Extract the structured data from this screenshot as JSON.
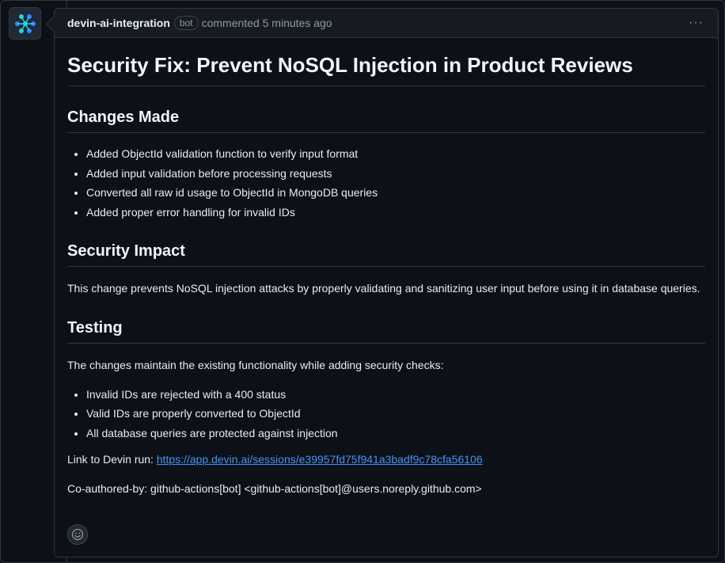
{
  "comment": {
    "author": "devin-ai-integration",
    "badge": "bot",
    "meta": "commented 5 minutes ago",
    "menu_icon": "kebab-horizontal-icon",
    "avatar_icon": "devin-logo-icon"
  },
  "body": {
    "title": "Security Fix: Prevent NoSQL Injection in Product Reviews",
    "sections": [
      {
        "heading": "Changes Made",
        "items": [
          "Added ObjectId validation function to verify input format",
          "Added input validation before processing requests",
          "Converted all raw id usage to ObjectId in MongoDB queries",
          "Added proper error handling for invalid IDs"
        ]
      },
      {
        "heading": "Security Impact",
        "paragraph": "This change prevents NoSQL injection attacks by properly validating and sanitizing user input before using it in database queries."
      },
      {
        "heading": "Testing",
        "paragraph": "The changes maintain the existing functionality while adding security checks:",
        "items": [
          "Invalid IDs are rejected with a 400 status",
          "Valid IDs are properly converted to ObjectId",
          "All database queries are protected against injection"
        ]
      }
    ],
    "link_prefix": "Link to Devin run: ",
    "link_text": "https://app.devin.ai/sessions/e39957fd75f941a3badf9c78cfa56106",
    "coauthored": "Co-authored-by: github-actions[bot] <github-actions[bot]@users.noreply.github.com>"
  },
  "reaction_icon": "smiley-icon",
  "colors": {
    "background": "#0d1117",
    "header": "#161b22",
    "border": "#30363d",
    "link": "#4493f8",
    "muted": "#9198a1"
  }
}
